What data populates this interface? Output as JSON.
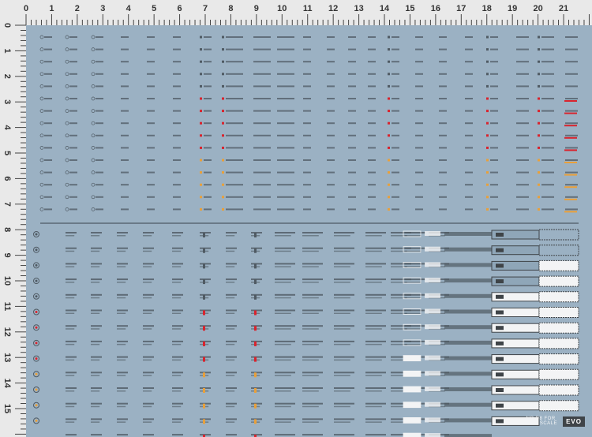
{
  "ruler": {
    "horizontal_labels": [
      "0",
      "1",
      "2",
      "3",
      "4",
      "5",
      "6",
      "7",
      "8",
      "9",
      "10",
      "11",
      "12",
      "13",
      "14",
      "15",
      "16",
      "17",
      "18",
      "19",
      "20",
      "21"
    ],
    "vertical_labels": [
      "0",
      "1",
      "2",
      "3",
      "4",
      "5",
      "6",
      "7",
      "8",
      "9",
      "10",
      "11",
      "12",
      "13",
      "14",
      "15"
    ]
  },
  "colors": {
    "sheet": "#9bb1c3",
    "ruler": "#e9e9e9",
    "ink_dark": "#4f5a63",
    "accent_red": "#d9232d",
    "accent_orange": "#e9a03a",
    "white": "#f3f4f5"
  },
  "upper_section": {
    "row_accents": [
      "dark",
      "dark",
      "dark",
      "dark",
      "dark",
      "red",
      "red",
      "red",
      "red",
      "red",
      "orange",
      "orange",
      "orange",
      "orange",
      "orange"
    ]
  },
  "lower_section": {
    "row_accents": [
      "dark",
      "dark",
      "dark",
      "dark",
      "dark",
      "red",
      "red",
      "red",
      "red",
      "orange",
      "orange",
      "orange",
      "orange",
      "mixed"
    ]
  },
  "footer": {
    "line1": "NO.D8 FOR",
    "line2": "1/100 SCALE",
    "brand": "EVO"
  }
}
